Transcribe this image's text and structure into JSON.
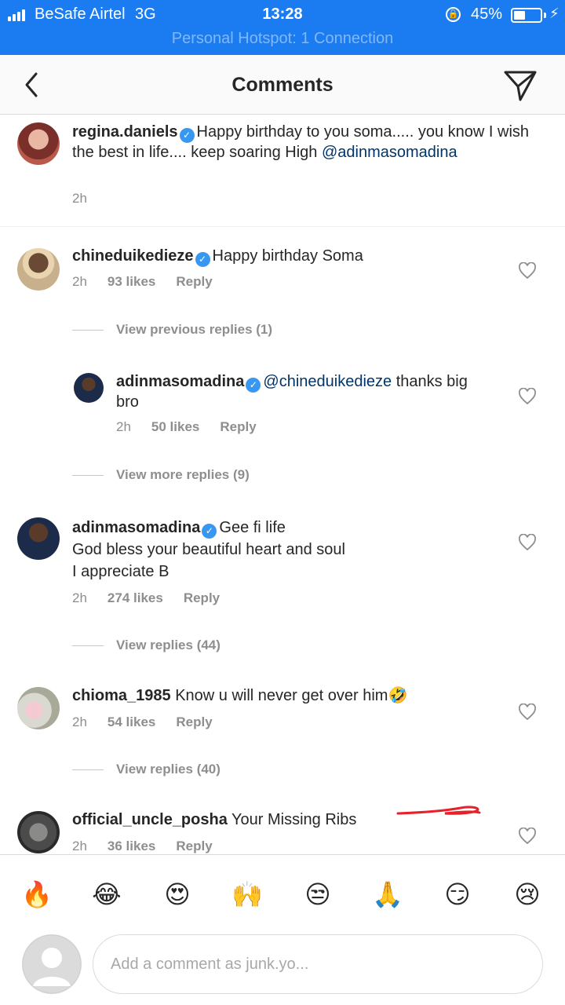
{
  "status_bar": {
    "carrier": "BeSafe Airtel",
    "network": "3G",
    "time": "13:28",
    "battery_percent": "45%",
    "battery_level": 0.45,
    "hotspot": "Personal Hotspot: 1 Connection"
  },
  "nav": {
    "title": "Comments"
  },
  "comments": [
    {
      "username": "regina.daniels",
      "verified": true,
      "text": "Happy birthday to you soma..... you know I wish the best in life.... keep soaring High",
      "mention": "@adinmasomadina",
      "time": "2h"
    },
    {
      "username": "chineduikedieze",
      "verified": true,
      "text": "Happy birthday Soma",
      "time": "2h",
      "likes": "93 likes",
      "reply": "Reply",
      "view_label": "View previous replies (1)"
    },
    {
      "username": "adinmasomadina",
      "verified": true,
      "mention": "@chineduikedieze",
      "text": "thanks big bro",
      "time": "2h",
      "likes": "50 likes",
      "reply": "Reply",
      "view_label": "View more replies (9)"
    },
    {
      "username": "adinmasomadina",
      "verified": true,
      "text": "Gee fi life",
      "line2": "God bless your beautiful heart and soul",
      "line3": "I appreciate B",
      "time": "2h",
      "likes": "274 likes",
      "reply": "Reply",
      "view_label": "View replies (44)"
    },
    {
      "username": "chioma_1985",
      "verified": false,
      "text": "Know u will never get over him",
      "emoji": "🤣",
      "time": "2h",
      "likes": "54 likes",
      "reply": "Reply",
      "view_label": "View replies (40)"
    },
    {
      "username": "official_uncle_posha",
      "verified": false,
      "text": "Your Missing Ribs",
      "time": "2h",
      "likes": "36 likes",
      "reply": "Reply"
    }
  ],
  "quick_emojis": [
    "🔥",
    "😂",
    "😍",
    "🙌",
    "😒",
    "🙏",
    "😏",
    "😢"
  ],
  "composer": {
    "placeholder": "Add a comment as junk.yo..."
  },
  "colors": {
    "status_bar": "#1a7cf0",
    "verified": "#3897f0",
    "mention": "#003569",
    "annotation": "#e8202a"
  }
}
